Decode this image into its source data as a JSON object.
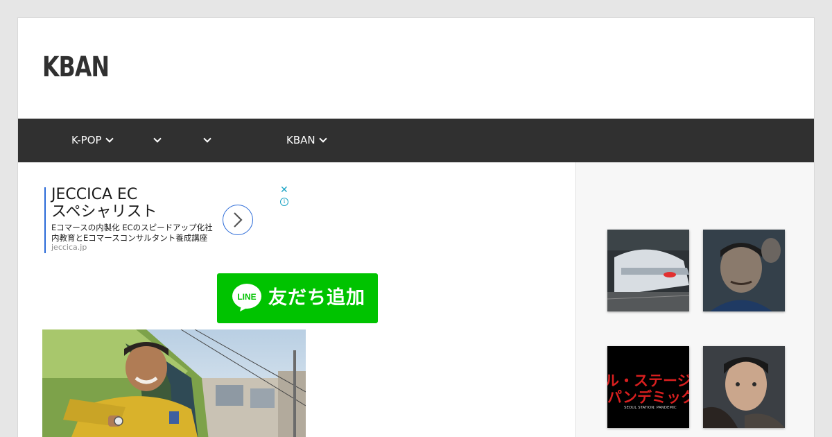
{
  "site": {
    "title": "KBAN"
  },
  "nav": {
    "items": [
      {
        "label": "K-POP"
      },
      {
        "label": ""
      },
      {
        "label": ""
      },
      {
        "label": "KBAN"
      }
    ]
  },
  "ad": {
    "title_line1": "JECCICA EC",
    "title_line2": "スペシャリスト",
    "desc_line1": "Eコマースの内製化 ECのスピードアップ化社",
    "desc_line2": "内教育とEコマースコンサルタント養成講座",
    "domain": "jeccica.jp",
    "close_glyph": "✕",
    "info_glyph": "i"
  },
  "line_button": {
    "logo_text": "LINE",
    "label": "友だち追加"
  },
  "sidebar": {
    "thumbs": [
      {
        "name": "train"
      },
      {
        "name": "actor"
      },
      {
        "name": "title-card",
        "line1": "ル・ステージ",
        "line2": "パンデミック",
        "caption": "SEOUL STATION: PANDEMIC"
      },
      {
        "name": "man-portrait"
      }
    ]
  },
  "colors": {
    "nav_bg": "#303030",
    "line_green": "#00c300",
    "ad_accent": "#2a6ad8",
    "page_bg": "#e6e6e6"
  }
}
